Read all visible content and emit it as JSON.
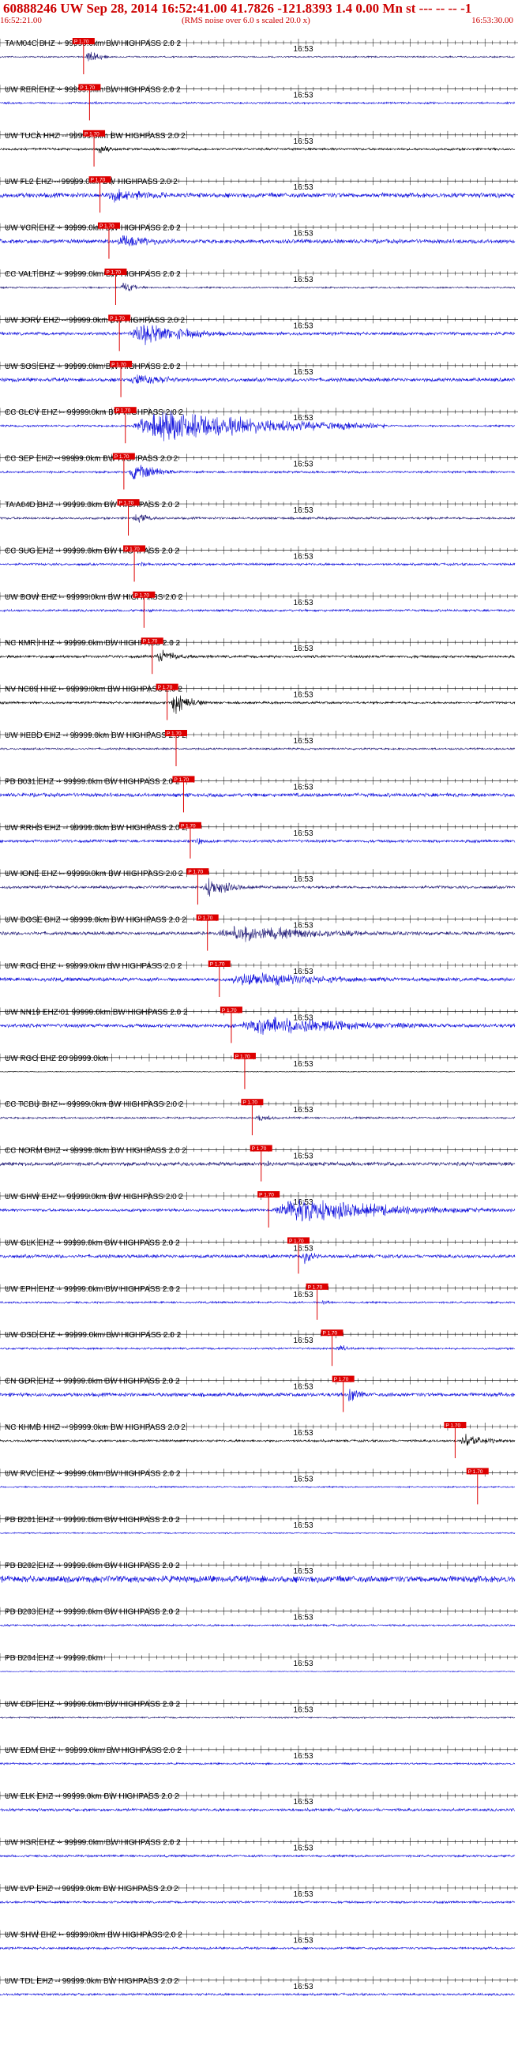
{
  "header": {
    "title": "60888246 UW Sep 28, 2014 16:52:41.00   41.7826 -121.8393  1.4 0.00 Mn st --- -- --  -1",
    "start_time": "16:52:21.00",
    "scale_note": "(RMS noise over 6.0 s scaled 20.0 x)",
    "end_time": "16:53:30.00"
  },
  "colors": {
    "header_red": "#cc0000",
    "trace_blue": "#1414dd",
    "trace_black": "#000000",
    "trace_navy": "#26207a",
    "pick_red": "#dd0000"
  },
  "chart_data": {
    "type": "line",
    "title": "60888246 UW Sep 28, 2014 16:52:41.00   41.7826 -121.8393  1.4 0.00 Mn st --- -- --  -1",
    "x_start": "16:52:21.00",
    "x_end": "16:53:30.00",
    "xlim": [
      0,
      69
    ],
    "tick_label": "16:53",
    "series": [
      {
        "name": "TA.M04C.BHZ",
        "label": "TA M04C BHZ -- 99999.0km BW  HIGHPASS  2.0  2",
        "color": "#26207a",
        "amp": 0.8,
        "pick": 11.2,
        "pick_text": "P 1.70",
        "burst": {
          "t": 11.5,
          "dur": 3,
          "amp": 12
        }
      },
      {
        "name": "UW.RER.EHZ",
        "label": "UW RER EHZ -- 99999.0km BW  HIGHPASS  2.0  2",
        "color": "#1414dd",
        "amp": 1.0,
        "pick": 12.0,
        "pick_text": "P 1.70",
        "burst": {
          "t": 12.5,
          "dur": 2,
          "amp": 3
        }
      },
      {
        "name": "UW.TUCA.HHZ",
        "label": "UW TUCA HHZ -- 99999.0km BW  HIGHPASS  2.0  2",
        "color": "#000000",
        "amp": 1.2,
        "pick": 12.6,
        "pick_text": "P 1.70",
        "burst": {
          "t": 13.0,
          "dur": 3,
          "amp": 8
        }
      },
      {
        "name": "UW.FL2.EHZ",
        "label": "UW FL2 EHZ -- 99999.0km BW  HIGHPASS  2.0  2",
        "color": "#1414dd",
        "amp": 2.5,
        "pick": 13.4,
        "pick_text": "P 1.70",
        "burst": {
          "t": 13.8,
          "dur": 14,
          "amp": 10
        }
      },
      {
        "name": "UW.VCR.EHZ",
        "label": "UW VCR EHZ -- 99999.0km BW  HIGHPASS  2.0  2",
        "color": "#1414dd",
        "amp": 2.2,
        "pick": 14.6,
        "pick_text": "P 1.70",
        "burst": {
          "t": 15.0,
          "dur": 12,
          "amp": 9
        }
      },
      {
        "name": "CC.VALT.BHZ",
        "label": "CC VALT BHZ -- 99999.0km BW  HIGHPASS  2.0  2",
        "color": "#26207a",
        "amp": 0.9,
        "pick": 15.5,
        "pick_text": "P 1.70",
        "burst": {
          "t": 16.0,
          "dur": 4,
          "amp": 8
        }
      },
      {
        "name": "UW.JORV.EHZ",
        "label": "UW JORV EHZ -- 99999.0km BW  HIGHPASS  2.0  2",
        "color": "#1414dd",
        "amp": 1.6,
        "pick": 16.0,
        "pick_text": "P 1.70",
        "burst": {
          "t": 17.0,
          "dur": 16,
          "amp": 15
        }
      },
      {
        "name": "UW.SOS.EHZ",
        "label": "UW SOS EHZ -- 99999.0km BW  HIGHPASS  2.0  2",
        "color": "#1414dd",
        "amp": 2.0,
        "pick": 16.2,
        "pick_text": "P 1.70",
        "burst": {
          "t": 17.0,
          "dur": 12,
          "amp": 9
        }
      },
      {
        "name": "CC.CLCV.EHZ",
        "label": "CC CLCV EHZ -- 99999.0km BW  HIGHPASS  2.0  2",
        "color": "#1414dd",
        "amp": 1.0,
        "pick": 16.8,
        "pick_text": "P 1.70",
        "burst": {
          "t": 17.5,
          "dur": 34,
          "amp": 22
        }
      },
      {
        "name": "CC.SEP.EHZ",
        "label": "CC SEP EHZ -- 99999.0km BW  HIGHPASS  2.0  2",
        "color": "#1414dd",
        "amp": 1.2,
        "pick": 16.6,
        "pick_text": "P 1.70",
        "burst": {
          "t": 17.2,
          "dur": 6,
          "amp": 16
        }
      },
      {
        "name": "TA.A04D.BHZ",
        "label": "TA A04D BHZ -- 99999.0km BW  HIGHPASS  2.0  2",
        "color": "#26207a",
        "amp": 1.2,
        "pick": 17.2,
        "pick_text": "P 1.70",
        "burst": {
          "t": 17.6,
          "dur": 6,
          "amp": 6
        }
      },
      {
        "name": "CC.SUG.EHZ",
        "label": "CC SUG EHZ -- 99999.0km BW  HIGHPASS  2.0  2",
        "color": "#1414dd",
        "amp": 1.2,
        "pick": 18.0,
        "pick_text": "P 1.70",
        "burst": {
          "t": 18.5,
          "dur": 3,
          "amp": 4
        }
      },
      {
        "name": "UW.BOW.EHZ",
        "label": "UW BOW EHZ -- 99999.0km BW  HIGHPASS  2.0  2",
        "color": "#1414dd",
        "amp": 1.2,
        "pick": 19.3,
        "pick_text": "P 1.70",
        "burst": {
          "t": 19.8,
          "dur": 2,
          "amp": 3
        }
      },
      {
        "name": "NC.KMR.HHZ",
        "label": "NC KMR HHZ -- 99999.0km BW  HIGHPASS  2.0  2",
        "color": "#000000",
        "amp": 1.4,
        "pick": 20.4,
        "pick_text": "P 1.70",
        "burst": {
          "t": 20.8,
          "dur": 6,
          "amp": 9
        }
      },
      {
        "name": "NV.NC89.HHZ",
        "label": "NV NC89 HHZ -- 99999.0km BW  HIGHPASS  2.0  2",
        "color": "#000000",
        "amp": 1.2,
        "pick": 22.4,
        "pick_text": "P 1.70",
        "burst": {
          "t": 22.8,
          "dur": 5,
          "amp": 16
        }
      },
      {
        "name": "UW.HEBO.EHZ",
        "label": "UW HEBO EHZ -- 99999.0km BW  HIGHPASS  2.0  2",
        "color": "#26207a",
        "amp": 1.0,
        "pick": 23.6,
        "pick_text": "P 1.70",
        "burst": {
          "t": 24.0,
          "dur": 2,
          "amp": 2
        }
      },
      {
        "name": "PB.B031.EHZ",
        "label": "PB B031 EHZ -- 99999.0km BW  HIGHPASS  2.0  2",
        "color": "#1414dd",
        "amp": 2.0,
        "pick": 24.6,
        "pick_text": "P 1.70",
        "burst": {
          "t": 25.0,
          "dur": 2,
          "amp": 3
        }
      },
      {
        "name": "UW.RRHS.EHZ",
        "label": "UW RRHS EHZ -- 99999.0km BW  HIGHPASS  2.0  2",
        "color": "#1414dd",
        "amp": 1.5,
        "pick": 25.5,
        "pick_text": "P 1.70",
        "burst": {
          "t": 26.0,
          "dur": 4,
          "amp": 5
        }
      },
      {
        "name": "UW.IONE.EHZ",
        "label": "UW IONE EHZ -- 99999.0km BW  HIGHPASS  2.0  2",
        "color": "#26207a",
        "amp": 1.5,
        "pick": 26.5,
        "pick_text": "P 1.70",
        "burst": {
          "t": 27.0,
          "dur": 8,
          "amp": 12
        }
      },
      {
        "name": "UW.DOSE.BHZ",
        "label": "UW DOSE BHZ -- 99999.0km BW  HIGHPASS  2.0  2",
        "color": "#26207a",
        "amp": 1.8,
        "pick": 27.8,
        "pick_text": "P 1.70",
        "burst": {
          "t": 28.4,
          "dur": 30,
          "amp": 11
        }
      },
      {
        "name": "UW.RGO.EHZ",
        "label": "UW RGO EHZ -- 99999.0km BW  HIGHPASS  2.0  2",
        "color": "#1414dd",
        "amp": 2.0,
        "pick": 29.4,
        "pick_text": "P 1.70",
        "burst": {
          "t": 30.0,
          "dur": 28,
          "amp": 10
        }
      },
      {
        "name": "UW.NN19.EHZ",
        "label": "UW NN19 EHZ 01 99999.0km BW  HIGHPASS  2.0  2",
        "color": "#1414dd",
        "amp": 2.0,
        "pick": 31.0,
        "pick_text": "P 1.70",
        "burst": {
          "t": 31.6,
          "dur": 30,
          "amp": 13
        }
      },
      {
        "name": "UW.RGO.EHZ.20",
        "label": "UW RGO EHZ 20 99999.0km",
        "color": "#000000",
        "amp": 0.4,
        "pick": 32.8,
        "pick_text": "P 1.70",
        "burst": null
      },
      {
        "name": "CC.TCBU.BHZ",
        "label": "CC TCBU BHZ -- 99999.0km BW  HIGHPASS  2.0  2",
        "color": "#26207a",
        "amp": 1.0,
        "pick": 33.8,
        "pick_text": "P 1.70",
        "burst": {
          "t": 34.2,
          "dur": 4,
          "amp": 6
        }
      },
      {
        "name": "CC.NORM.BHZ",
        "label": "CC NORM BHZ -- 99999.0km BW  HIGHPASS  2.0  2",
        "color": "#26207a",
        "amp": 2.0,
        "pick": 35.0,
        "pick_text": "P 1.70",
        "burst": {
          "t": 35.4,
          "dur": 4,
          "amp": 4
        }
      },
      {
        "name": "UW.GHW.EHZ",
        "label": "UW GHW EHZ -- 99999.0km BW  HIGHPASS  2.0  2",
        "color": "#1414dd",
        "amp": 1.5,
        "pick": 36.0,
        "pick_text": "P 1.70",
        "burst": {
          "t": 36.0,
          "dur": 33,
          "amp": 16
        }
      },
      {
        "name": "UW.GLK.EHZ",
        "label": "UW GLK EHZ -- 99999.0km BW  HIGHPASS  2.0  2",
        "color": "#1414dd",
        "amp": 1.8,
        "pick": 40.0,
        "pick_text": "P 1.70",
        "burst": {
          "t": 40.4,
          "dur": 3,
          "amp": 12
        }
      },
      {
        "name": "UW.EPH.EHZ",
        "label": "UW EPH EHZ -- 99999.0km BW  HIGHPASS  2.0  2",
        "color": "#1414dd",
        "amp": 1.0,
        "pick": 42.5,
        "pick_text": "P 1.70",
        "burst": {
          "t": 43.0,
          "dur": 2,
          "amp": 6
        }
      },
      {
        "name": "UW.OSD.EHZ",
        "label": "UW OSD EHZ -- 99999.0km BW  HIGHPASS  2.0  2",
        "color": "#1414dd",
        "amp": 1.0,
        "pick": 44.5,
        "pick_text": "P 1.70",
        "burst": {
          "t": 45.0,
          "dur": 3,
          "amp": 7
        }
      },
      {
        "name": "CN.GDR.EHZ",
        "label": "CN GDR EHZ -- 99999.0km BW  HIGHPASS  2.0  2",
        "color": "#1414dd",
        "amp": 2.0,
        "pick": 46.0,
        "pick_text": "P 1.70",
        "burst": {
          "t": 46.5,
          "dur": 3,
          "amp": 14
        }
      },
      {
        "name": "NC.KHMB.HHZ",
        "label": "NC KHMB HHZ -- 99999.0km BW  HIGHPASS  2.0  2",
        "color": "#000000",
        "amp": 1.2,
        "pick": 61.0,
        "pick_text": "P 1.70",
        "burst": {
          "t": 61.5,
          "dur": 7,
          "amp": 9
        }
      },
      {
        "name": "UW.RVC.EHZ",
        "label": "UW RVC EHZ -- 99999.0km BW  HIGHPASS  2.0  2",
        "color": "#1414dd",
        "amp": 0.8,
        "pick": 64.0,
        "pick_text": "P 1.70",
        "burst": null
      },
      {
        "name": "PB.B201.EHZ",
        "label": "PB B201 EHZ -- 99999.0km BW  HIGHPASS  2.0  2",
        "color": "#1414dd",
        "amp": 0.7,
        "pick": null,
        "pick_text": "",
        "burst": null
      },
      {
        "name": "PB.B202.EHZ",
        "label": "PB B202 EHZ -- 99999.0km BW  HIGHPASS  2.0  2",
        "color": "#1414dd",
        "amp": 3.5,
        "pick": null,
        "pick_text": "",
        "burst": null
      },
      {
        "name": "PB.B203.EHZ",
        "label": "PB B203 EHZ -- 99999.0km BW  HIGHPASS  2.0  2",
        "color": "#1414dd",
        "amp": 1.0,
        "pick": null,
        "pick_text": "",
        "burst": null
      },
      {
        "name": "PB.B204.EHZ",
        "label": "PB B204 EHZ -- 99999.0km",
        "color": "#1414dd",
        "amp": 0.5,
        "pick": null,
        "pick_text": "",
        "burst": null
      },
      {
        "name": "UW.CDF.EHZ",
        "label": "UW CDF EHZ -- 99999.0km BW  HIGHPASS  2.0  2",
        "color": "#26207a",
        "amp": 0.8,
        "pick": null,
        "pick_text": "",
        "burst": null
      },
      {
        "name": "UW.EDM.EHZ",
        "label": "UW EDM EHZ -- 99999.0km BW  HIGHPASS  2.0  2",
        "color": "#1414dd",
        "amp": 1.0,
        "pick": null,
        "pick_text": "",
        "burst": null
      },
      {
        "name": "UW.ELK.EHZ",
        "label": "UW ELK EHZ -- 99999.0km BW  HIGHPASS  2.0  2",
        "color": "#1414dd",
        "amp": 1.5,
        "pick": null,
        "pick_text": "",
        "burst": null
      },
      {
        "name": "UW.HSR.EHZ",
        "label": "UW HSR EHZ -- 99999.0km BW  HIGHPASS  2.0  2",
        "color": "#1414dd",
        "amp": 1.2,
        "pick": null,
        "pick_text": "",
        "burst": null
      },
      {
        "name": "UW.LVP.EHZ",
        "label": "UW LVP EHZ -- 99999.0km BW  HIGHPASS  2.0  2",
        "color": "#1414dd",
        "amp": 1.2,
        "pick": null,
        "pick_text": "",
        "burst": null
      },
      {
        "name": "UW.SHW.EHZ",
        "label": "UW SHW EHZ -- 99999.0km BW  HIGHPASS  2.0  2",
        "color": "#1414dd",
        "amp": 1.2,
        "pick": null,
        "pick_text": "",
        "burst": null
      },
      {
        "name": "UW.TDL.EHZ",
        "label": "UW TDL EHZ -- 99999.0km BW  HIGHPASS  2.0  2",
        "color": "#1414dd",
        "amp": 1.2,
        "pick": null,
        "pick_text": "",
        "burst": null
      }
    ]
  }
}
